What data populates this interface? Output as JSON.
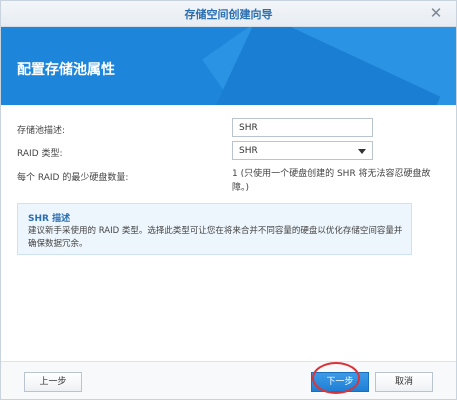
{
  "window": {
    "title": "存储空间创建向导"
  },
  "header": {
    "title": "配置存储池属性"
  },
  "form": {
    "description_label": "存储池描述:",
    "description_value": "SHR",
    "raid_type_label": "RAID 类型:",
    "raid_type_value": "SHR",
    "min_disks_label": "每个 RAID 的最少硬盘数量:",
    "min_disks_value": "1 (只使用一个硬盘创建的 SHR 将无法容忍硬盘故障。)"
  },
  "info": {
    "title": "SHR 描述",
    "body": "建议新手采使用的 RAID 类型。选择此类型可让您在将来合并不同容量的硬盘以优化存储空间容量并确保数据冗余。"
  },
  "footer": {
    "prev_label": "上一步",
    "next_label": "下一步",
    "cancel_label": "取消"
  },
  "colors": {
    "accent": "#1e86da",
    "highlight": "#d9343a"
  },
  "icons": {
    "close": "close-icon",
    "dropdown": "chevron-down-icon"
  }
}
